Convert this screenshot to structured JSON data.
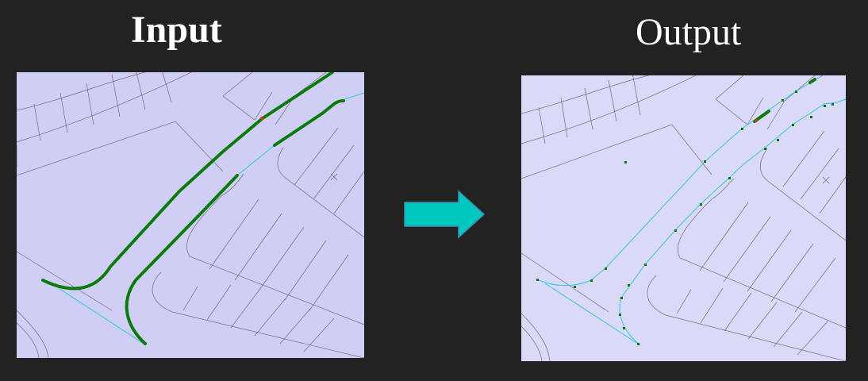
{
  "titles": {
    "input": "Input",
    "output": "Output"
  },
  "colors": {
    "background": "#222222",
    "title_text": "#ffffff",
    "input_map_fill": "#cfcff5",
    "output_map_fill": "#dadaf8",
    "parcel_lines": "#6e6e7e",
    "road_centerline": "#2ec7e8",
    "vertex_markers": "#0b7a0b",
    "selected_vertex": "#e03020",
    "arrow_fill": "#00c8c0",
    "arrow_outline": "#3a8fb0"
  },
  "icons": {
    "arrow": "right-arrow-icon"
  }
}
